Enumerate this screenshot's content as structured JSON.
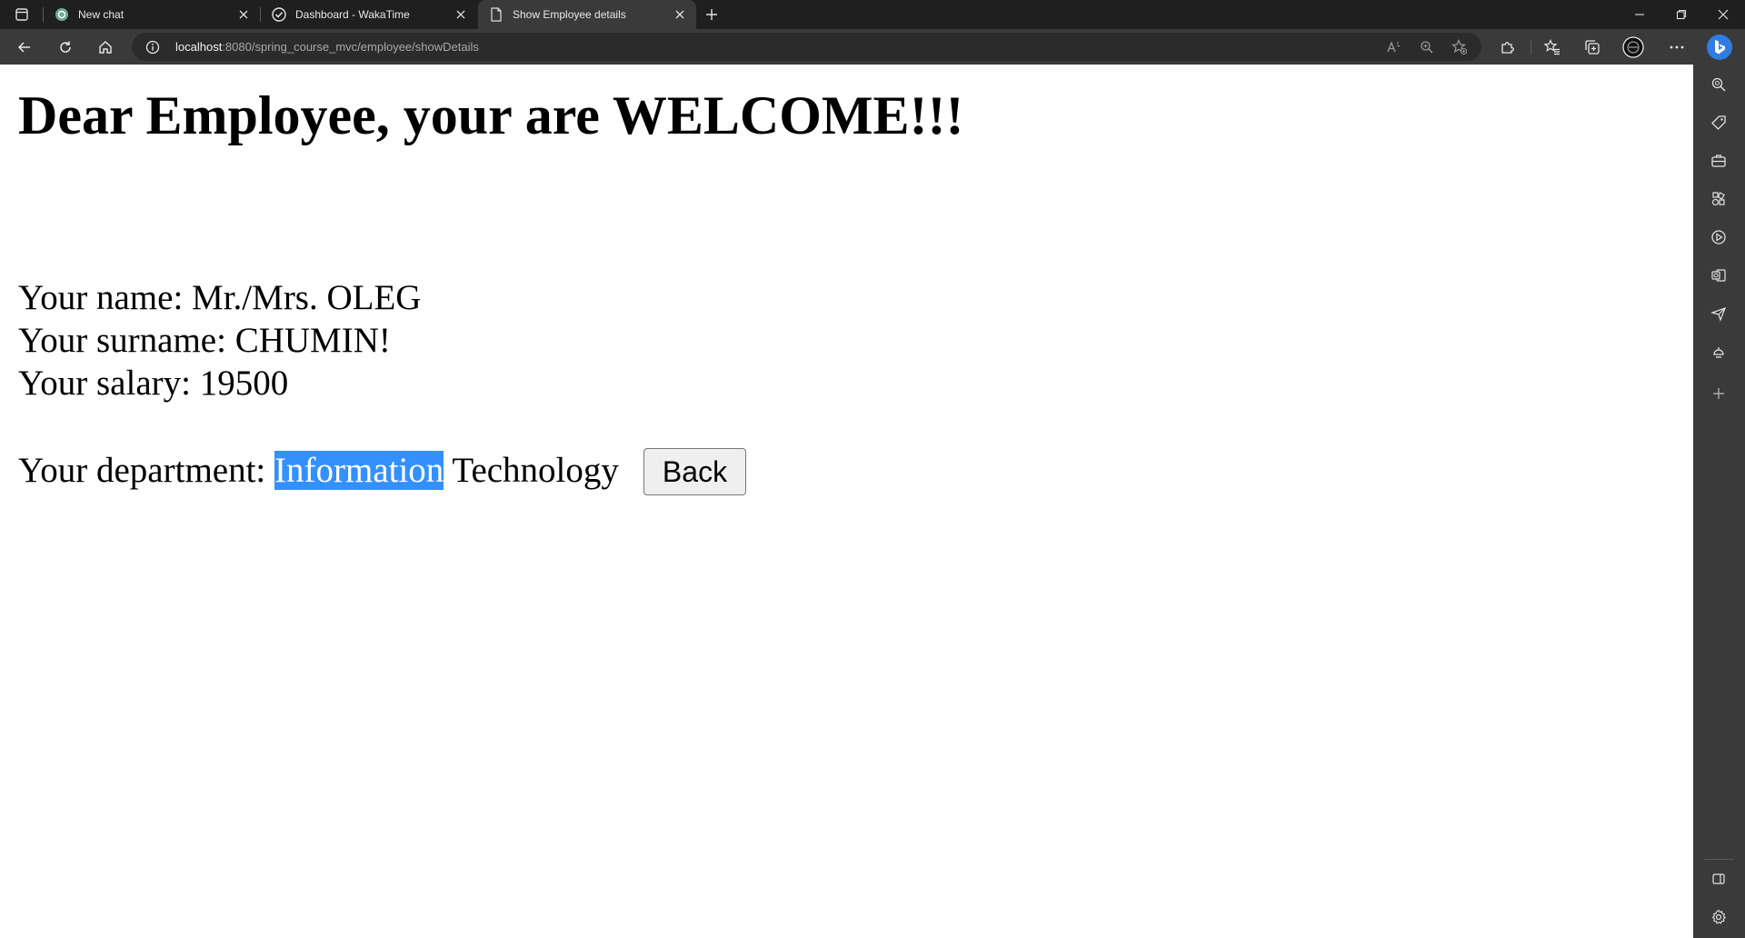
{
  "browser": {
    "tabs": [
      {
        "title": "New chat",
        "icon": "chatgpt-icon",
        "active": false
      },
      {
        "title": "Dashboard - WakaTime",
        "icon": "wakatime-icon",
        "active": false
      },
      {
        "title": "Show Employee details",
        "icon": "page-icon",
        "active": true
      }
    ],
    "url": {
      "host": "localhost",
      "path": ":8080/spring_course_mvc/employee/showDetails"
    }
  },
  "page": {
    "heading": "Dear Employee, your are WELCOME!!!",
    "name_label": "Your name: ",
    "name_value": "Mr./Mrs. OLEG",
    "surname_label": "Your surname: ",
    "surname_value": "CHUMIN!",
    "salary_label": "Your salary: ",
    "salary_value": "19500",
    "department_label": "Your department: ",
    "department_selected": "Information",
    "department_rest": " Technology",
    "back_button": "Back"
  },
  "colors": {
    "selection": "#3390ff",
    "browser_chrome": "#3a3a3a",
    "tabstrip": "#1f1f1f"
  }
}
